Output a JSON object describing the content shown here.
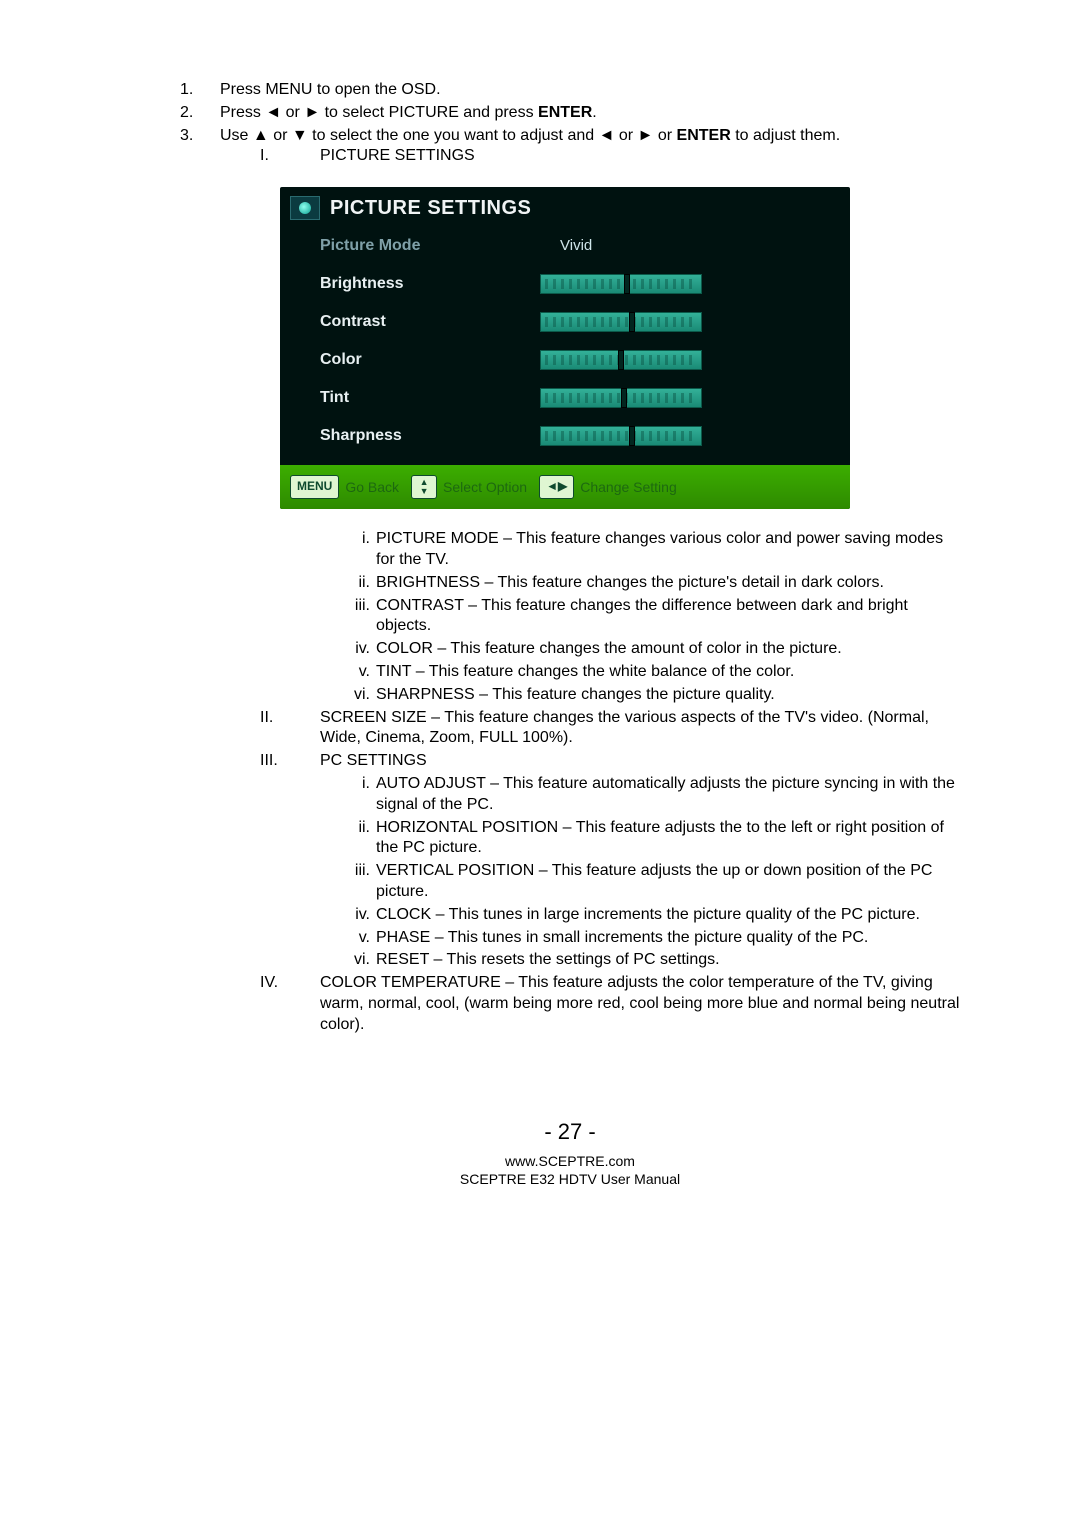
{
  "steps": {
    "s1": "Press MENU to open the OSD.",
    "s2a": "Press ",
    "s2b": " or ",
    "s2c": " to select PICTURE and press ",
    "s2d": "ENTER",
    "s2e": ".",
    "s3a": "Use ",
    "s3b": " or ",
    "s3c": " to select the one you want to adjust and ",
    "s3d": " or ",
    "s3e": " or ",
    "s3f": "ENTER",
    "s3g": " to adjust them."
  },
  "glyph": {
    "left": "◄",
    "right": "►",
    "up": "▲",
    "down": "▼"
  },
  "roman1": "PICTURE SETTINGS",
  "osd": {
    "title": "PICTURE SETTINGS",
    "rows": [
      {
        "label": "Picture Mode",
        "value": "Vivid",
        "slider": null
      },
      {
        "label": "Brightness",
        "slider": 52
      },
      {
        "label": "Contrast",
        "slider": 55
      },
      {
        "label": "Color",
        "slider": 48
      },
      {
        "label": "Tint",
        "slider": 50
      },
      {
        "label": "Sharpness",
        "slider": 55
      }
    ],
    "footer": {
      "menu": "MENU",
      "go_back": "Go Back",
      "select": "Select Option",
      "change": "Change Setting"
    }
  },
  "inner_i": [
    "PICTURE MODE – This feature changes various color and power saving modes for the TV.",
    "BRIGHTNESS – This feature changes the picture's detail in dark colors.",
    "CONTRAST – This feature changes the difference between dark and bright objects.",
    "COLOR – This feature changes the amount of color in the picture.",
    "TINT – This feature changes the white balance of the color.",
    "SHARPNESS – This feature changes the picture quality."
  ],
  "roman2": "SCREEN SIZE – This feature changes the various aspects of the TV's video.  (Normal, Wide, Cinema, Zoom, FULL 100%).",
  "roman3": "PC SETTINGS",
  "inner_iii": [
    "AUTO ADJUST – This feature automatically adjusts the picture syncing in with the signal of the PC.",
    "HORIZONTAL POSITION – This feature adjusts the to the left or right position of the PC picture.",
    "VERTICAL POSITION – This feature adjusts the up or down position of the PC picture.",
    "CLOCK – This tunes in large increments the picture quality of the PC picture.",
    "PHASE – This tunes in small increments the picture quality of the PC.",
    "RESET – This resets the settings of PC settings."
  ],
  "roman4": "COLOR TEMPERATURE – This feature adjusts the color temperature of the TV, giving warm, normal, cool, (warm being more red, cool being more blue and normal being neutral color).",
  "footer": {
    "page": "- 27 -",
    "url": "www.SCEPTRE.com",
    "manual": "SCEPTRE E32 HDTV User Manual"
  }
}
